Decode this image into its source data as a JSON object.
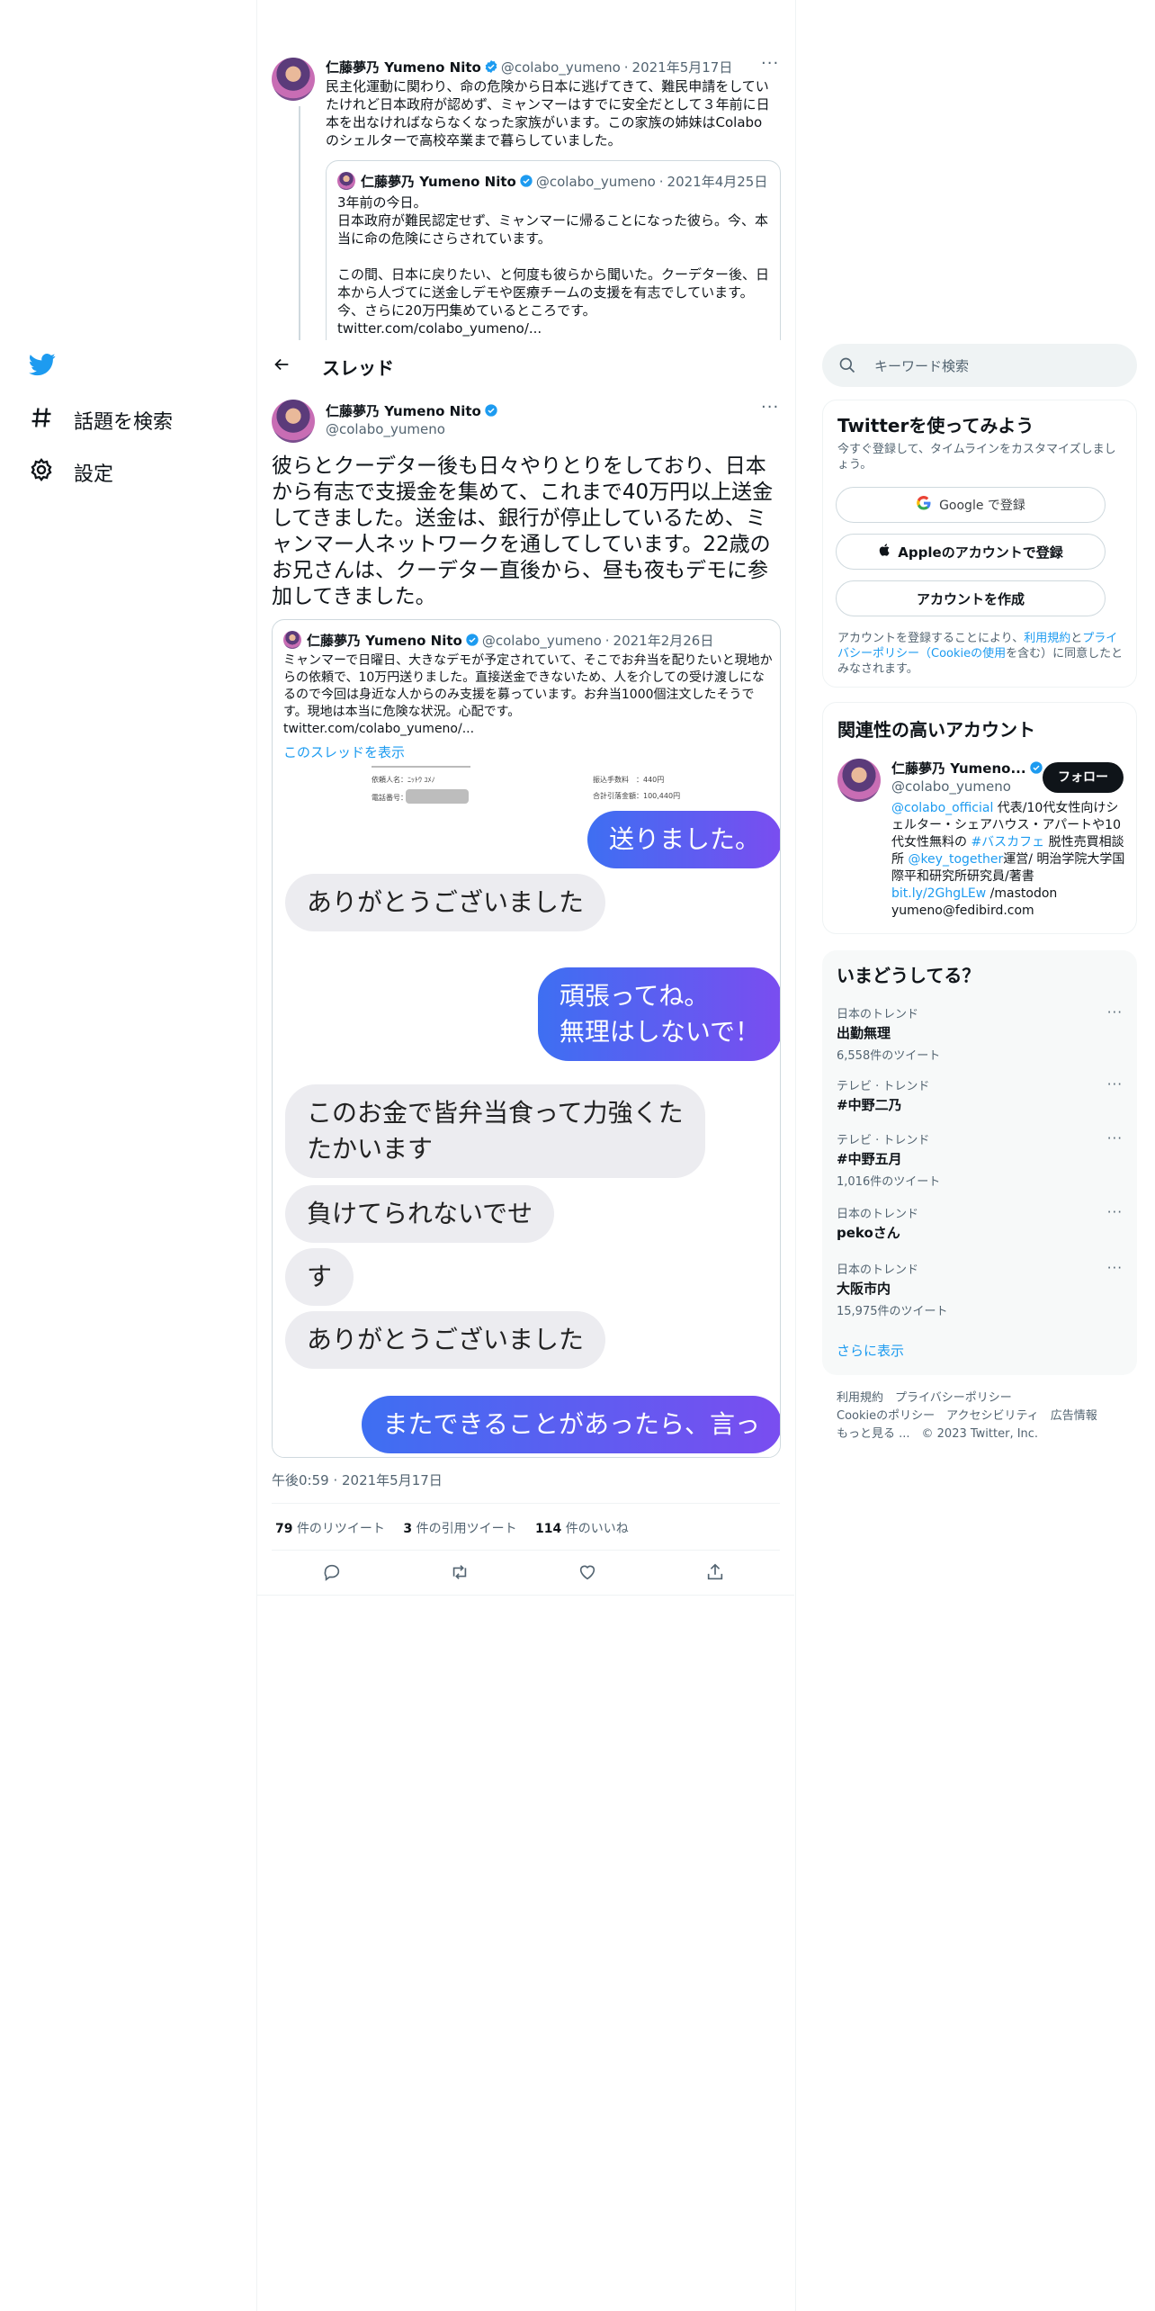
{
  "nav": {
    "explore_label": "話題を検索",
    "settings_label": "設定"
  },
  "header": {
    "title": "スレッド"
  },
  "parent_tweet": {
    "name": "仁藤夢乃 Yumeno Nito",
    "handle": "@colabo_yumeno",
    "dot": "·",
    "date": "2021年5月17日",
    "text": "民主化運動に関わり、命の危険から日本に逃げてきて、難民申請をしていたけれど日本政府が認めず、ミャンマーはすでに安全だとして３年前に日本を出なければならなくなった家族がいます。この家族の姉妹はColaboのシェルターで高校卒業まで暮らしていました。",
    "quote": {
      "name": "仁藤夢乃 Yumeno Nito",
      "handle": "@colabo_yumeno",
      "date": "2021年4月25日",
      "text": "3年前の今日。\n日本政府が難民認定せず、ミャンマーに帰ることになった彼ら。今、本当に命の危険にさらされています。\n\nこの間、日本に戻りたい、と何度も彼らから聞いた。クーデター後、日本から人づてに送金しデモや医療チームの支援を有志でしています。\n今、さらに20万円集めているところです。\ntwitter.com/colabo_yumeno/..."
    }
  },
  "main_tweet": {
    "name": "仁藤夢乃 Yumeno Nito",
    "handle": "@colabo_yumeno",
    "text": "彼らとクーデター後も日々やりとりをしており、日本から有志で支援金を集めて、これまで40万円以上送金してきました。送金は、銀行が停止しているため、ミャンマー人ネットワークを通してしています。22歳のお兄さんは、クーデター直後から、昼も夜もデモに参加してきました。",
    "quote": {
      "name": "仁藤夢乃 Yumeno Nito",
      "handle": "@colabo_yumeno",
      "date": "2021年2月26日",
      "text": "ミャンマーで日曜日、大きなデモが予定されていて、そこでお弁当を配りたいと現地からの依頼で、10万円送りました。直接送金できないため、人を介しての受け渡しになるので今回は身近な人からのみ支援を募っています。お弁当1000個注文したそうです。現地は本当に危険な状況。心配です。\ntwitter.com/colabo_yumeno/...",
      "show_thread": "このスレッドを表示"
    },
    "receipt": {
      "requester_label": "依頼人名：ﾆｯﾄｳ ﾕﾒﾉ",
      "phone_label": "電話番号：",
      "fee_label": "振込手数料　：440円",
      "total_label": "合計引落金額：100,440円"
    },
    "chat": [
      {
        "side": "out",
        "text": "送りました。"
      },
      {
        "side": "in",
        "text": "ありがとうございました"
      },
      {
        "side": "out",
        "text": "頑張ってね。\n無理はしないで！"
      },
      {
        "side": "in",
        "text": "このお金で皆弁当食って力強くた\nたかいます"
      },
      {
        "side": "in",
        "text": "負けてられないでせ"
      },
      {
        "side": "in",
        "text": "す"
      },
      {
        "side": "in",
        "text": "ありがとうございました"
      },
      {
        "side": "out",
        "text": "またできることがあったら、言っ"
      }
    ],
    "timestamp": "午後0:59 · 2021年5月17日",
    "stats": {
      "retweets": "79",
      "retweets_label": "件のリツイート",
      "quotes": "3",
      "quotes_label": "件の引用ツイート",
      "likes": "114",
      "likes_label": "件のいいね"
    }
  },
  "search": {
    "placeholder": "キーワード検索"
  },
  "signup": {
    "title": "Twitterを使ってみよう",
    "subtitle": "今すぐ登録して、タイムラインをカスタマイズしましょう。",
    "google_label": "Google で登録",
    "apple_label": "Appleのアカウントで登録",
    "create_label": "アカウントを作成",
    "terms_prefix": "アカウントを登録することにより、",
    "terms_link": "利用規約",
    "terms_and": "と",
    "privacy_link": "プライバシーポリシー（Cookieの使用",
    "terms_suffix": "を含む）に同意したとみなされます。"
  },
  "related": {
    "title": "関連性の高いアカウント",
    "name": "仁藤夢乃 Yumeno...",
    "handle": "@colabo_yumeno",
    "follow_label": "フォロー",
    "bio_link1": "@colabo_official",
    "bio_1": " 代表/10代女性向けシェルター・シェアハウス・アパートや10代女性無料の ",
    "bio_link2": "#バスカフェ",
    "bio_2": " 脱性売買相談所 ",
    "bio_link3": "@key_together",
    "bio_3": "運営/ 明治学院大学国際平和研究所研究員/著書",
    "bio_link4": "bit.ly/2GhgLEw",
    "bio_4": " /mastodon yumeno@fedibird.com"
  },
  "trends": {
    "title": "いまどうしてる？",
    "items": [
      {
        "category": "日本のトレンド",
        "name": "出勤無理",
        "count": "6,558件のツイート"
      },
      {
        "category": "テレビ · トレンド",
        "name": "#中野二乃",
        "count": ""
      },
      {
        "category": "テレビ · トレンド",
        "name": "#中野五月",
        "count": "1,016件のツイート"
      },
      {
        "category": "日本のトレンド",
        "name": "pekoさん",
        "count": ""
      },
      {
        "category": "日本のトレンド",
        "name": "大阪市内",
        "count": "15,975件のツイート"
      }
    ],
    "show_more": "さらに表示"
  },
  "footer": {
    "line1": "利用規約　プライバシーポリシー",
    "line2": "Cookieのポリシー　アクセシビリティ　広告情報",
    "line3": "もっと見る ...　© 2023 Twitter, Inc."
  },
  "colors": {
    "accent": "#1d9bf0",
    "text": "#0f1419",
    "muted": "#536471"
  }
}
